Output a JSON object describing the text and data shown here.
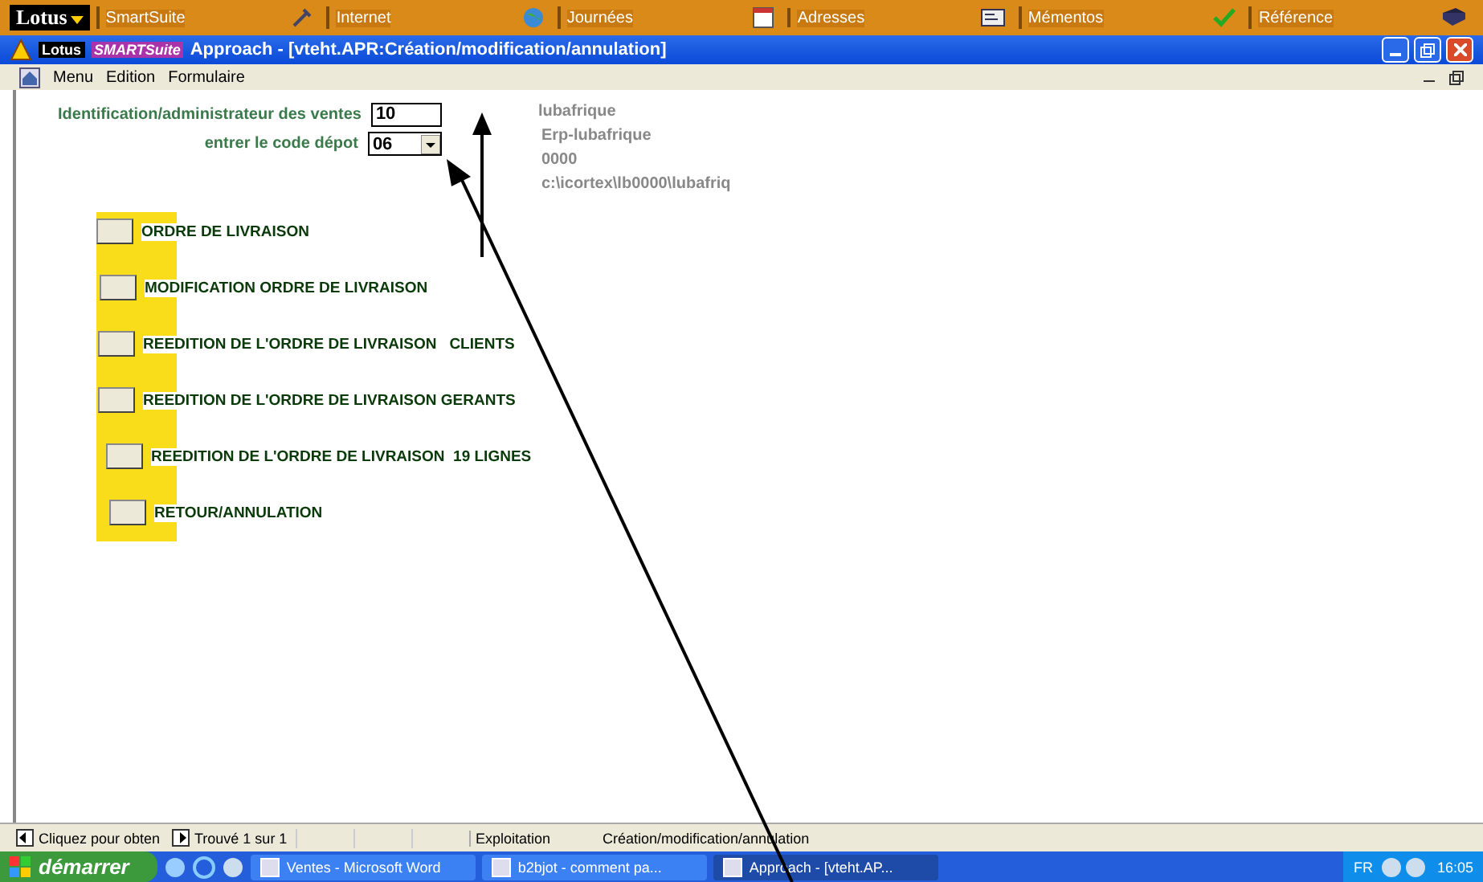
{
  "suite_bar": {
    "logo": "Lotus",
    "items": [
      {
        "label": "SmartSuite"
      },
      {
        "label": "Internet"
      },
      {
        "label": "Journées"
      },
      {
        "label": "Adresses"
      },
      {
        "label": "Mémentos"
      },
      {
        "label": "Référence"
      }
    ]
  },
  "window": {
    "brand": "Lotus",
    "brand_2": "SMARTSuite",
    "title": "Approach - [vteht.APR:Création/modification/annulation]"
  },
  "menu": [
    "Menu",
    "Edition",
    "Formulaire"
  ],
  "form": {
    "fields": [
      {
        "label": "Identification/administrateur des ventes",
        "value": "10",
        "kind": "text"
      },
      {
        "label": "entrer le code dépot",
        "value": "06",
        "kind": "dropdown"
      }
    ],
    "info": [
      "lubafrique",
      "Erp-lubafrique",
      "0000",
      "c:\\icortex\\lb0000\\lubafriq"
    ],
    "actions": [
      "ORDRE DE LIVRAISON",
      "MODIFICATION ORDRE DE LIVRAISON",
      "REEDITION DE L'ORDRE DE LIVRAISON   CLIENTS",
      "REEDITION DE L'ORDRE DE LIVRAISON GERANTS",
      "REEDITION DE L'ORDRE DE LIVRAISON  19 LIGNES",
      "RETOUR/ANNULATION"
    ]
  },
  "status_bar": {
    "hint": "Cliquez pour obten",
    "found": "Trouvé 1 sur 1",
    "mode": "Exploitation",
    "form_name": "Création/modification/annulation"
  },
  "taskbar": {
    "start": "démarrer",
    "tasks": [
      {
        "label": "Ventes - Microsoft Word",
        "selected": false
      },
      {
        "label": "b2bjot - comment pa...",
        "selected": false
      },
      {
        "label": "Approach - [vteht.AP...",
        "selected": true
      }
    ],
    "lang": "FR",
    "clock": "16:05"
  }
}
